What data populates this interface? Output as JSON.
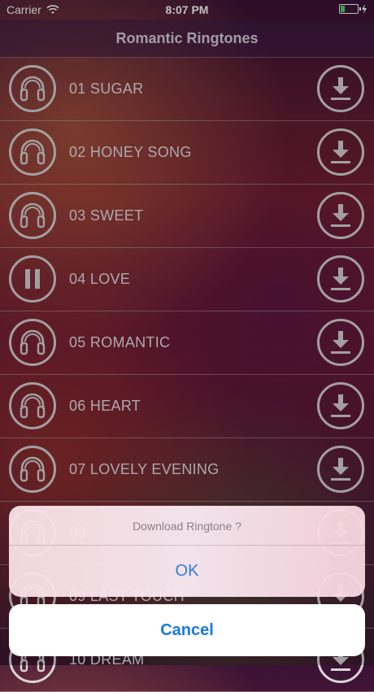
{
  "status_bar": {
    "carrier": "Carrier",
    "time": "8:07 PM"
  },
  "nav": {
    "title": "Romantic Ringtones"
  },
  "ringtones": [
    {
      "label": "01 SUGAR",
      "state": "headphones-icon"
    },
    {
      "label": "02 HONEY SONG",
      "state": "headphones-icon"
    },
    {
      "label": "03 SWEET",
      "state": "headphones-icon"
    },
    {
      "label": "04 LOVE",
      "state": "pause-icon"
    },
    {
      "label": "05 ROMANTIC",
      "state": "headphones-icon"
    },
    {
      "label": "06 HEART",
      "state": "headphones-icon"
    },
    {
      "label": "07 LOVELY EVENING",
      "state": "headphones-icon"
    },
    {
      "label": "08",
      "state": "headphones-icon"
    },
    {
      "label": "09 LAST TOUCH",
      "state": "headphones-icon"
    },
    {
      "label": "10 DREAM",
      "state": "headphones-icon"
    }
  ],
  "alert": {
    "message": "Download Ringtone ?",
    "ok": "OK",
    "cancel": "Cancel"
  },
  "colors": {
    "accent": "#1a78e6",
    "battery": "#4cd964"
  }
}
